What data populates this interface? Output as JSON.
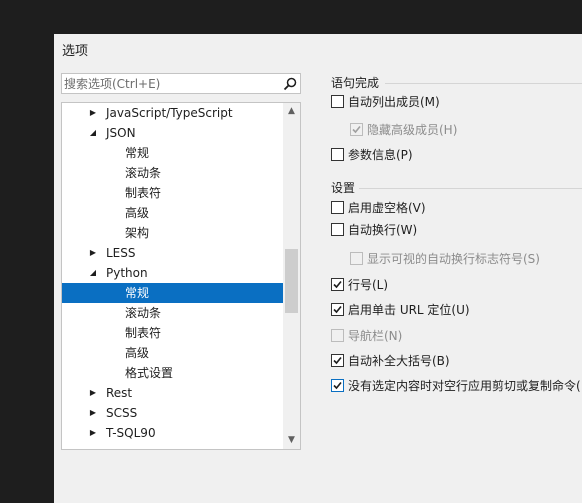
{
  "dialog": {
    "title": "选项"
  },
  "search": {
    "placeholder": "搜索选项(Ctrl+E)"
  },
  "tree": {
    "items": [
      {
        "label": "JavaScript/TypeScript",
        "expander": "collapsed",
        "selected": false
      },
      {
        "label": "JSON",
        "expander": "expanded",
        "selected": false
      },
      {
        "label": "常规",
        "expander": "none",
        "selected": false
      },
      {
        "label": "滚动条",
        "expander": "none",
        "selected": false
      },
      {
        "label": "制表符",
        "expander": "none",
        "selected": false
      },
      {
        "label": "高级",
        "expander": "none",
        "selected": false
      },
      {
        "label": "架构",
        "expander": "none",
        "selected": false
      },
      {
        "label": "LESS",
        "expander": "collapsed",
        "selected": false
      },
      {
        "label": "Python",
        "expander": "expanded",
        "selected": false
      },
      {
        "label": "常规",
        "expander": "none",
        "selected": true
      },
      {
        "label": "滚动条",
        "expander": "none",
        "selected": false
      },
      {
        "label": "制表符",
        "expander": "none",
        "selected": false
      },
      {
        "label": "高级",
        "expander": "none",
        "selected": false
      },
      {
        "label": "格式设置",
        "expander": "none",
        "selected": false
      },
      {
        "label": "Rest",
        "expander": "collapsed",
        "selected": false
      },
      {
        "label": "SCSS",
        "expander": "collapsed",
        "selected": false
      },
      {
        "label": "T-SQL90",
        "expander": "collapsed",
        "selected": false
      }
    ]
  },
  "statement_completion": {
    "title": "语句完成",
    "options": [
      {
        "label": "自动列出成员(M)",
        "checked": false,
        "enabled": true
      },
      {
        "label": "隐藏高级成员(H)",
        "checked": true,
        "enabled": false
      },
      {
        "label": "参数信息(P)",
        "checked": false,
        "enabled": true
      }
    ]
  },
  "settings": {
    "title": "设置",
    "options": [
      {
        "label": "启用虚空格(V)",
        "checked": false,
        "enabled": true
      },
      {
        "label": "自动换行(W)",
        "checked": false,
        "enabled": true
      },
      {
        "label": "显示可视的自动换行标志符号(S)",
        "checked": false,
        "enabled": false
      },
      {
        "label": "行号(L)",
        "checked": true,
        "enabled": true
      },
      {
        "label": "启用单击 URL 定位(U)",
        "checked": true,
        "enabled": true
      },
      {
        "label": "导航栏(N)",
        "checked": false,
        "enabled": false
      },
      {
        "label": "自动补全大括号(B)",
        "checked": true,
        "enabled": true
      },
      {
        "label": "没有选定内容时对空行应用剪切或复制命令(",
        "checked": true,
        "enabled": true
      }
    ]
  }
}
